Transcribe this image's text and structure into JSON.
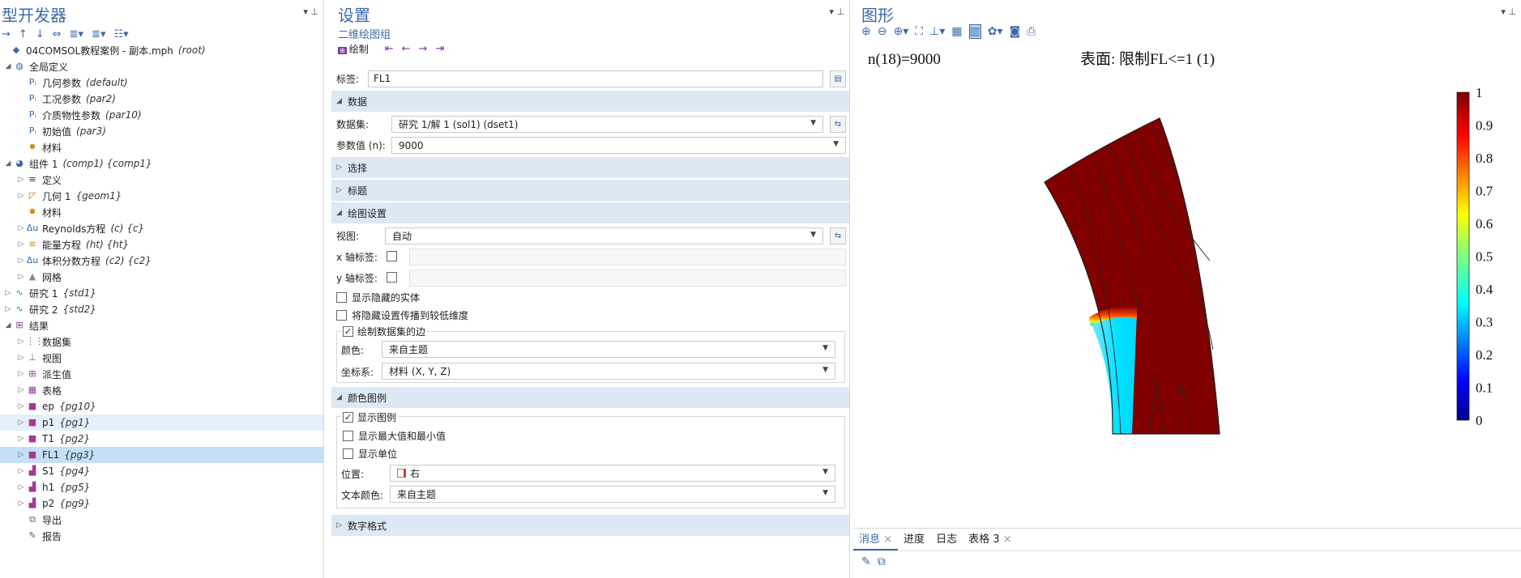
{
  "left": {
    "title": "型开发器",
    "tree": [
      {
        "label": "04COMSOL教程案例 - 副本.mph",
        "tag": "(root)",
        "icon": "model-icon",
        "level": 0,
        "tog": ""
      },
      {
        "label": "全局定义",
        "tag": "",
        "icon": "globe-icon",
        "level": 1,
        "tog": "▲"
      },
      {
        "label": "几何参数",
        "tag": "(default)",
        "icon": "param-icon",
        "level": 2,
        "tog": ""
      },
      {
        "label": "工况参数",
        "tag": "(par2)",
        "icon": "param-icon",
        "level": 2,
        "tog": ""
      },
      {
        "label": "介质物性参数",
        "tag": "(par10)",
        "icon": "param-icon",
        "level": 2,
        "tog": ""
      },
      {
        "label": "初始值",
        "tag": "(par3)",
        "icon": "param-icon",
        "level": 2,
        "tog": ""
      },
      {
        "label": "材料",
        "tag": "",
        "icon": "materials-icon",
        "level": 2,
        "tog": ""
      },
      {
        "label": "组件 1",
        "tag": "(comp1) {comp1}",
        "icon": "component-icon",
        "level": 1,
        "tog": "▲"
      },
      {
        "label": "定义",
        "tag": "",
        "icon": "definitions-icon",
        "level": 2,
        "tog": "▷"
      },
      {
        "label": "几何 1",
        "tag": "{geom1}",
        "icon": "geometry-icon",
        "level": 2,
        "tog": "▷"
      },
      {
        "label": "材料",
        "tag": "",
        "icon": "materials-icon",
        "level": 2,
        "tog": ""
      },
      {
        "label": "Reynolds方程",
        "tag": "(c) {c}",
        "icon": "pde-icon",
        "level": 2,
        "tog": "▷"
      },
      {
        "label": "能量方程",
        "tag": "(ht) {ht}",
        "icon": "heat-icon",
        "level": 2,
        "tog": "▷"
      },
      {
        "label": "体积分数方程",
        "tag": "(c2) {c2}",
        "icon": "pde-icon",
        "level": 2,
        "tog": "▷"
      },
      {
        "label": "网格",
        "tag": "",
        "icon": "mesh-icon",
        "level": 2,
        "tog": "▷"
      },
      {
        "label": "研究 1",
        "tag": "{std1}",
        "icon": "study-icon",
        "level": 1,
        "tog": "▷"
      },
      {
        "label": "研究 2",
        "tag": "{std2}",
        "icon": "study-icon",
        "level": 1,
        "tog": "▷"
      },
      {
        "label": "结果",
        "tag": "",
        "icon": "results-icon",
        "level": 1,
        "tog": "▲"
      },
      {
        "label": "数据集",
        "tag": "",
        "icon": "datasets-icon",
        "level": 2,
        "tog": "▷"
      },
      {
        "label": "视图",
        "tag": "",
        "icon": "views-icon",
        "level": 2,
        "tog": "▷"
      },
      {
        "label": "派生值",
        "tag": "",
        "icon": "derived-values-icon",
        "level": 2,
        "tog": "▷"
      },
      {
        "label": "表格",
        "tag": "",
        "icon": "tables-icon",
        "level": 2,
        "tog": "▷"
      },
      {
        "label": "ep",
        "tag": "{pg10}",
        "icon": "plot-group-icon",
        "level": 2,
        "tog": "▷"
      },
      {
        "label": "p1",
        "tag": "{pg1}",
        "icon": "plot-group-icon",
        "level": 2,
        "tog": "▷",
        "state": "hl"
      },
      {
        "label": "T1",
        "tag": "{pg2}",
        "icon": "plot-group-icon",
        "level": 2,
        "tog": "▷"
      },
      {
        "label": "FL1",
        "tag": "{pg3}",
        "icon": "plot-group-icon",
        "level": 2,
        "tog": "▷",
        "state": "sel"
      },
      {
        "label": "S1",
        "tag": "{pg4}",
        "icon": "plot-group-1d-icon",
        "level": 2,
        "tog": "▷"
      },
      {
        "label": "h1",
        "tag": "{pg5}",
        "icon": "plot-group-1d-icon",
        "level": 2,
        "tog": "▷"
      },
      {
        "label": "p2",
        "tag": "{pg9}",
        "icon": "plot-group-1d-icon",
        "level": 2,
        "tog": "▷"
      },
      {
        "label": "导出",
        "tag": "",
        "icon": "export-icon",
        "level": 2,
        "tog": ""
      },
      {
        "label": "报告",
        "tag": "",
        "icon": "report-icon",
        "level": 2,
        "tog": ""
      }
    ]
  },
  "mid": {
    "title": "设置",
    "subtitle": "二维绘图组",
    "plot_label": "绘制",
    "label_field": {
      "label": "标签:",
      "value": "FL1"
    },
    "sections": {
      "data": "数据",
      "selection": "选择",
      "title": "标题",
      "plot_settings": "绘图设置",
      "color_legend": "颜色图例",
      "number_format": "数字格式"
    },
    "dataset": {
      "label": "数据集:",
      "value": "研究 1/解 1 (sol1) (dset1)"
    },
    "param": {
      "label": "参数值 (n):",
      "value": "9000"
    },
    "view": {
      "label": "视图:",
      "value": "自动"
    },
    "xlabel": {
      "label": "x 轴标签:"
    },
    "ylabel": {
      "label": "y 轴标签:"
    },
    "show_hidden": "显示隐藏的实体",
    "propagate": "将隐藏设置传播到较低维度",
    "plot_edges": "绘制数据集的边",
    "color": {
      "label": "颜色:",
      "value": "来自主题"
    },
    "frame": {
      "label": "坐标系:",
      "value": "材料  (X, Y, Z)"
    },
    "show_legend": "显示图例",
    "show_minmax": "显示最大值和最小值",
    "show_units": "显示单位",
    "position": {
      "label": "位置:",
      "value": "右"
    },
    "text_color": {
      "label": "文本颜色:",
      "value": "来自主题"
    }
  },
  "right": {
    "title": "图形",
    "plot_left_title": "n(18)=9000",
    "plot_right_title": "表面: 限制FL<=1 (1)",
    "colorbar_ticks": [
      "1",
      "0.9",
      "0.8",
      "0.7",
      "0.6",
      "0.5",
      "0.4",
      "0.3",
      "0.2",
      "0.1",
      "0"
    ],
    "tabs": [
      "消息",
      "进度",
      "日志",
      "表格 3"
    ]
  }
}
